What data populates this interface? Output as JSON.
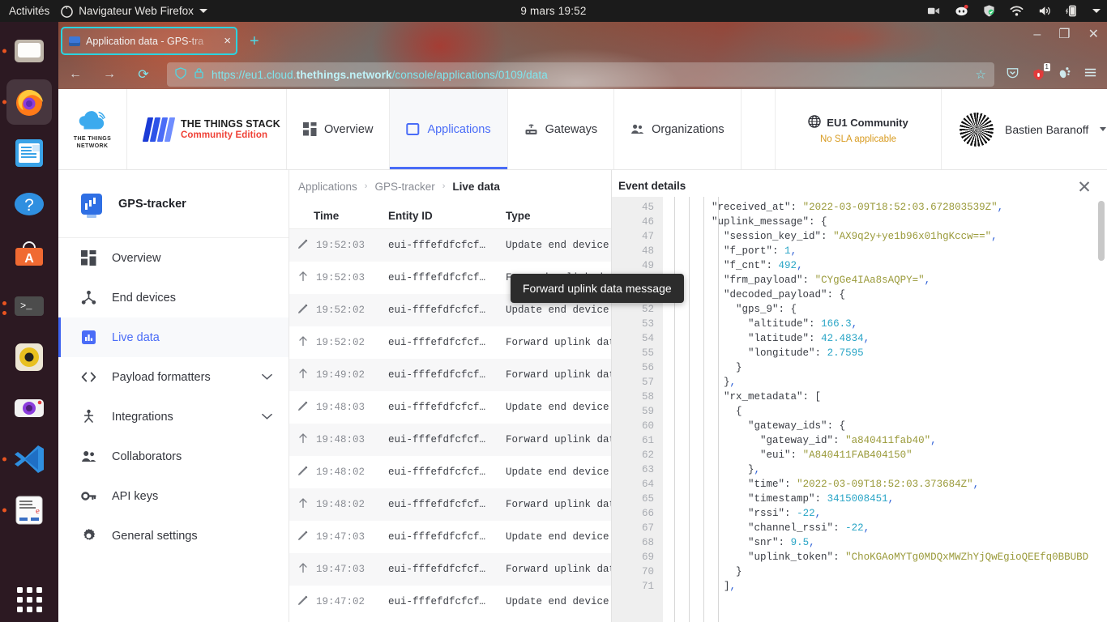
{
  "desktop": {
    "activities": "Activités",
    "app_menu": "Navigateur Web Firefox",
    "clock": "9 mars  19:52",
    "tray_icons": [
      "screencast-icon",
      "discord-icon",
      "shield-icon",
      "wifi-icon",
      "volume-icon",
      "battery-icon",
      "caret-down-icon"
    ],
    "dock_items": [
      {
        "name": "files-icon",
        "running": false
      },
      {
        "name": "firefox-icon",
        "running": true,
        "active": true
      },
      {
        "name": "libreoffice-writer-icon",
        "running": false
      },
      {
        "name": "help-icon",
        "running": false
      },
      {
        "name": "ubuntu-software-icon",
        "running": false
      },
      {
        "name": "terminal-icon",
        "running": true
      },
      {
        "name": "rhythmbox-icon",
        "running": false
      },
      {
        "name": "cheese-camera-icon",
        "running": false
      },
      {
        "name": "vscode-icon",
        "running": true
      },
      {
        "name": "reader-icon",
        "running": true
      },
      {
        "name": "show-applications-icon",
        "running": false
      }
    ]
  },
  "browser": {
    "tab_title": "Application data - GPS-tra",
    "tab_close": "×",
    "new_tab": "+",
    "window_controls": {
      "minimize": "–",
      "maximize": "❐",
      "close": "✕"
    },
    "nav": {
      "back": "←",
      "forward": "→",
      "reload": "⟳"
    },
    "url_prefix": "https://eu1.cloud.",
    "url_bold": "thethings.network",
    "url_suffix": "/console/applications/0109/data",
    "url_full": "https://eu1.cloud.thethings.network/console/applications/0109/data",
    "bookmark_star": "☆",
    "extension_badge": "1"
  },
  "ttn_header": {
    "brand_line1": "THE THINGS",
    "brand_line2": "NETWORK",
    "stack_name": "THE THINGS STACK",
    "stack_edition": "Community Edition",
    "nav": [
      {
        "label": "Overview",
        "icon": "grid-icon",
        "active": false
      },
      {
        "label": "Applications",
        "icon": "application-icon",
        "active": true
      },
      {
        "label": "Gateways",
        "icon": "gateway-icon",
        "active": false
      },
      {
        "label": "Organizations",
        "icon": "organizations-icon",
        "active": false
      }
    ],
    "cluster": "EU1 Community",
    "cluster_sub": "No SLA applicable",
    "user_name": "Bastien Baranoff"
  },
  "sidebar": {
    "app_name": "GPS-tracker",
    "items": [
      {
        "label": "Overview",
        "icon": "grid-icon",
        "active": false,
        "expandable": false
      },
      {
        "label": "End devices",
        "icon": "device-icon",
        "active": false,
        "expandable": false
      },
      {
        "label": "Live data",
        "icon": "live-data-icon",
        "active": true,
        "expandable": false
      },
      {
        "label": "Payload formatters",
        "icon": "code-icon",
        "active": false,
        "expandable": true
      },
      {
        "label": "Integrations",
        "icon": "integration-icon",
        "active": false,
        "expandable": true
      },
      {
        "label": "Collaborators",
        "icon": "collaborators-icon",
        "active": false,
        "expandable": false
      },
      {
        "label": "API keys",
        "icon": "key-icon",
        "active": false,
        "expandable": false
      },
      {
        "label": "General settings",
        "icon": "gear-icon",
        "active": false,
        "expandable": false
      }
    ],
    "chevron": "⌄"
  },
  "breadcrumb": {
    "items": [
      "Applications",
      "GPS-tracker",
      "Live data"
    ],
    "separator": "›"
  },
  "table": {
    "headers": [
      "Time",
      "Entity ID",
      "Type"
    ],
    "rows": [
      {
        "icon": "pencil-icon",
        "time": "19:52:03",
        "entity_id": "eui-fffefdfcfcf…",
        "type": "Update end device"
      },
      {
        "icon": "uplink-arrow-icon",
        "time": "19:52:03",
        "entity_id": "eui-fffefdfcfcf…",
        "type": "Forward uplink data mes"
      },
      {
        "icon": "pencil-icon",
        "time": "19:52:02",
        "entity_id": "eui-fffefdfcfcf…",
        "type": "Update end device"
      },
      {
        "icon": "uplink-arrow-icon",
        "time": "19:52:02",
        "entity_id": "eui-fffefdfcfcf…",
        "type": "Forward uplink data mes"
      },
      {
        "icon": "uplink-arrow-icon",
        "time": "19:49:02",
        "entity_id": "eui-fffefdfcfcf…",
        "type": "Forward uplink data mes"
      },
      {
        "icon": "pencil-icon",
        "time": "19:48:03",
        "entity_id": "eui-fffefdfcfcf…",
        "type": "Update end device"
      },
      {
        "icon": "uplink-arrow-icon",
        "time": "19:48:03",
        "entity_id": "eui-fffefdfcfcf…",
        "type": "Forward uplink data mes"
      },
      {
        "icon": "pencil-icon",
        "time": "19:48:02",
        "entity_id": "eui-fffefdfcfcf…",
        "type": "Update end device"
      },
      {
        "icon": "uplink-arrow-icon",
        "time": "19:48:02",
        "entity_id": "eui-fffefdfcfcf…",
        "type": "Forward uplink data mes"
      },
      {
        "icon": "pencil-icon",
        "time": "19:47:03",
        "entity_id": "eui-fffefdfcfcf…",
        "type": "Update end device"
      },
      {
        "icon": "uplink-arrow-icon",
        "time": "19:47:03",
        "entity_id": "eui-fffefdfcfcf…",
        "type": "Forward uplink data mes"
      },
      {
        "icon": "pencil-icon",
        "time": "19:47:02",
        "entity_id": "eui-fffefdfcfcf…",
        "type": "Update end device"
      }
    ]
  },
  "tooltip": "Forward uplink data message",
  "event_details": {
    "title": "Event details",
    "close": "✕",
    "first_line_number": 45,
    "lines": [
      {
        "n": 45,
        "indent": 4,
        "text": "\"received_at\": \"2022-03-09T18:52:03.672803539Z\","
      },
      {
        "n": 46,
        "indent": 4,
        "text": "\"uplink_message\": {"
      },
      {
        "n": 47,
        "indent": 5,
        "text": "\"session_key_id\": \"AX9q2y+ye1b96x01hgKccw==\","
      },
      {
        "n": 48,
        "indent": 5,
        "text": "\"f_port\": 1,"
      },
      {
        "n": 49,
        "indent": 5,
        "text": "\"f_cnt\": 492,"
      },
      {
        "n": 50,
        "indent": 5,
        "text": "\"frm_payload\": \"CYgGe4IAa8sAQPY=\","
      },
      {
        "n": 51,
        "indent": 5,
        "text": "\"decoded_payload\": {"
      },
      {
        "n": 52,
        "indent": 6,
        "text": "\"gps_9\": {"
      },
      {
        "n": 53,
        "indent": 7,
        "text": "\"altitude\": 166.3,"
      },
      {
        "n": 54,
        "indent": 7,
        "text": "\"latitude\": 42.4834,"
      },
      {
        "n": 55,
        "indent": 7,
        "text": "\"longitude\": 2.7595"
      },
      {
        "n": 56,
        "indent": 6,
        "text": "}"
      },
      {
        "n": 57,
        "indent": 5,
        "text": "},"
      },
      {
        "n": 58,
        "indent": 5,
        "text": "\"rx_metadata\": ["
      },
      {
        "n": 59,
        "indent": 6,
        "text": "{"
      },
      {
        "n": 60,
        "indent": 7,
        "text": "\"gateway_ids\": {"
      },
      {
        "n": 61,
        "indent": 8,
        "text": "\"gateway_id\": \"a840411fab40\","
      },
      {
        "n": 62,
        "indent": 8,
        "text": "\"eui\": \"A840411FAB404150\""
      },
      {
        "n": 63,
        "indent": 7,
        "text": "},"
      },
      {
        "n": 64,
        "indent": 7,
        "text": "\"time\": \"2022-03-09T18:52:03.373684Z\","
      },
      {
        "n": 65,
        "indent": 7,
        "text": "\"timestamp\": 3415008451,"
      },
      {
        "n": 66,
        "indent": 7,
        "text": "\"rssi\": -22,"
      },
      {
        "n": 67,
        "indent": 7,
        "text": "\"channel_rssi\": -22,"
      },
      {
        "n": 68,
        "indent": 7,
        "text": "\"snr\": 9.5,"
      },
      {
        "n": 69,
        "indent": 7,
        "text": "\"uplink_token\": \"ChoKGAoMYTg0MDQxMWZhYjQwEgioQEEfq0BBUBD"
      },
      {
        "n": 70,
        "indent": 6,
        "text": "}"
      },
      {
        "n": 71,
        "indent": 5,
        "text": "],"
      }
    ]
  },
  "colors": {
    "accent": "#4a6cf7",
    "brand_red": "#ef4136",
    "warning": "#d89b20",
    "json_string": "#9a9a3a",
    "json_number": "#29a5c6",
    "ubuntu_orange": "#e95420"
  }
}
